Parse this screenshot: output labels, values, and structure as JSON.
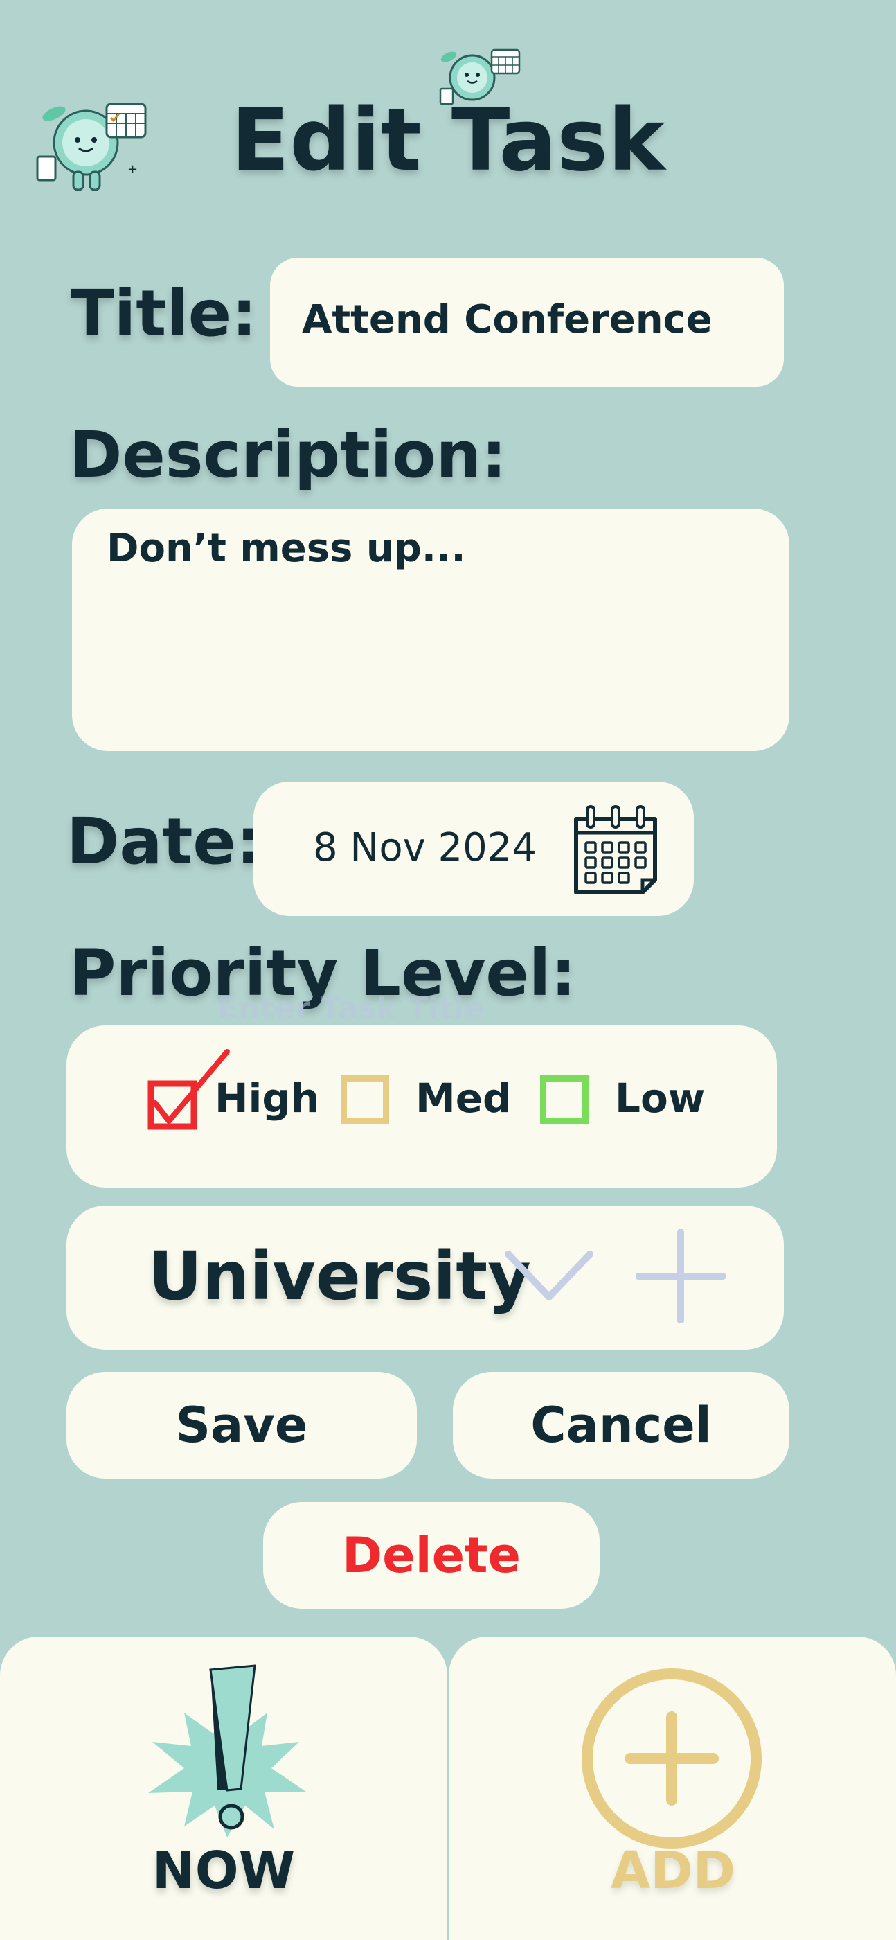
{
  "header": {
    "title": "Edit Task"
  },
  "form": {
    "title_label": "Title:",
    "title_value": "Attend Conference",
    "description_label": "Description:",
    "description_value": "Don’t mess up...",
    "date_label": "Date:",
    "date_value": "8 Nov 2024",
    "priority_label": "Priority Level:",
    "priority_options": [
      {
        "label": "High",
        "color": "#ee2a2e",
        "checked": true
      },
      {
        "label": "Med",
        "color": "#e7cc86",
        "checked": false
      },
      {
        "label": "Low",
        "color": "#7bdc5b",
        "checked": false
      }
    ],
    "ghost_text": "Enter Task Title",
    "category_value": "University"
  },
  "actions": {
    "save_label": "Save",
    "cancel_label": "Cancel",
    "delete_label": "Delete"
  },
  "bottom_nav": {
    "now_label": "NOW",
    "add_label": "ADD"
  },
  "colors": {
    "background": "#b3d3cf",
    "card": "#fafbee",
    "text": "#122a33",
    "danger": "#ee2a2e",
    "accent_gold": "#e7cc86",
    "muted_blue": "#c5d0e6",
    "mint": "#9edbcf"
  }
}
